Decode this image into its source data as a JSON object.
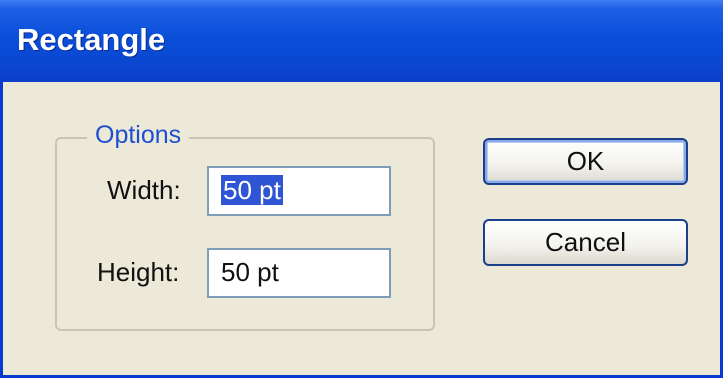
{
  "window": {
    "title": "Rectangle"
  },
  "options": {
    "legend": "Options",
    "width_label": "Width:",
    "width_value": "50 pt",
    "height_label": "Height:",
    "height_value": "50 pt"
  },
  "buttons": {
    "ok_label": "OK",
    "cancel_label": "Cancel"
  },
  "colors": {
    "titlebar_blue": "#0a4ed8",
    "dialog_bg": "#ece9d8",
    "legend_text": "#1d4fcf",
    "selection": "#2f55d4"
  }
}
